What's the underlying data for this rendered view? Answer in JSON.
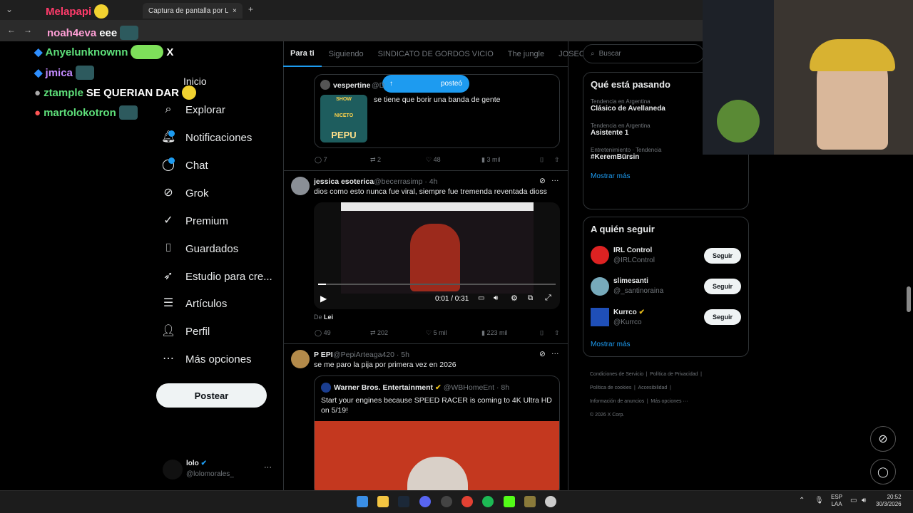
{
  "browser": {
    "tab1_title": "Captura de pantalla por Lightsh",
    "new_tab": "+",
    "close_tab": "×"
  },
  "chat": [
    {
      "user": "Melapapi",
      "msg": ""
    },
    {
      "user": "noah4eva",
      "msg": " eee"
    },
    {
      "user": "Anyelunknownn",
      "msg": ""
    },
    {
      "user": "jmica",
      "msg": ""
    },
    {
      "user": "ztample",
      "msg": "SE QUERIAN DAR"
    },
    {
      "user": "martolokotron",
      "msg": ""
    }
  ],
  "nav": {
    "home": "Inicio",
    "explore": "Explorar",
    "notifications": "Notificaciones",
    "chat": "Chat",
    "grok": "Grok",
    "premium": "Premium",
    "bookmarks": "Guardados",
    "studio": "Estudio para cre...",
    "articles": "Artículos",
    "profile": "Perfil",
    "more": "Más opciones",
    "post": "Postear",
    "user_name": "lolo",
    "user_handle": "@lolomorales_",
    "user_more": "···"
  },
  "feed_tabs": [
    "Para ti",
    "Siguiendo",
    "SINDICATO DE GORDOS VICIO",
    "The jungle",
    "JOSEO"
  ],
  "posted_pill": "posteó",
  "tweet1": {
    "name": "vespertine",
    "handle": "@D",
    "text": "se tiene que borir una banda de gente",
    "thumb_line1": "SHOW",
    "thumb_line2": "NICETO",
    "thumb_line3": "PEPU",
    "replies": "7",
    "retweets": "2",
    "likes": "48",
    "views": "3 mil"
  },
  "tweet2": {
    "name": "jessica esoterica",
    "handle": "@becerrasimp · 4h",
    "text": "dios como esto nunca fue viral, siempre fue tremenda reventada dioss",
    "video_time": "0:01 / 0:31",
    "from_label": "De",
    "from_user": "Lei",
    "replies": "49",
    "retweets": "202",
    "likes": "5 mil",
    "views": "223 mil"
  },
  "tweet3": {
    "name": "P EPI",
    "handle": "@PepiArteaga420 · 5h",
    "text": "se me paro la pija por primera vez en 2026",
    "quote_name": "Warner Bros. Entertainment",
    "quote_handle": "@WBHomeEnt · 8h",
    "quote_text": "Start your engines because SPEED RACER is coming to 4K Ultra HD on 5/19!"
  },
  "search_placeholder": "Buscar",
  "trends": {
    "title": "Qué está pasando",
    "items": [
      {
        "context": "Tendencia en Argentina",
        "name": "Clásico de Avellaneda"
      },
      {
        "context": "Tendencia en Argentina",
        "name": "Asistente 1"
      },
      {
        "context": "Entretenimiento · Tendencia",
        "name": "#KeremBürsin"
      }
    ],
    "show_more": "Mostrar más"
  },
  "who_to_follow": {
    "title": "A quién seguir",
    "items": [
      {
        "name": "IRL Control",
        "handle": "@IRLControl"
      },
      {
        "name": "slimesanti",
        "handle": "@_santinoraina"
      },
      {
        "name": "Kurrco",
        "handle": "@Kurrco"
      }
    ],
    "follow_label": "Seguir",
    "show_more": "Mostrar más"
  },
  "footer": {
    "terms": "Condiciones de Servicio",
    "privacy": "Política de Privacidad",
    "cookies": "Política de cookies",
    "accessibility": "Accesibilidad",
    "ads": "Información de anuncios",
    "more": "Más opciones ···",
    "copyright": "© 2026 X Corp."
  },
  "taskbar": {
    "lang1": "ESP",
    "lang2": "LAA",
    "time": "20:52",
    "date": "30/3/2026"
  },
  "colors": {
    "accent": "#1d9bf0",
    "background": "#000000",
    "border": "#2f3336",
    "muted": "#71767b"
  }
}
